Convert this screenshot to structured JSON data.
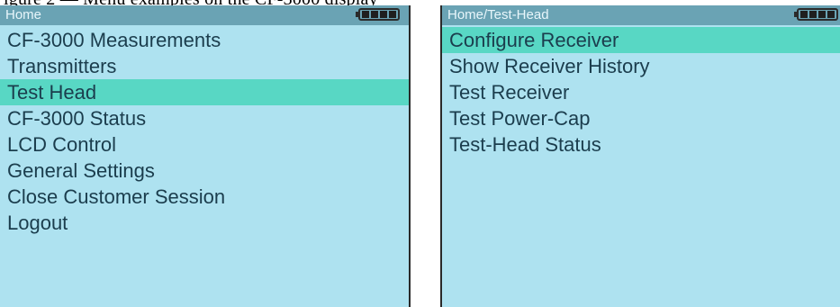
{
  "left_screen": {
    "breadcrumb": "Home",
    "battery_icon": "battery-full-icon",
    "menu_items": [
      {
        "label": "CF-3000 Measurements",
        "selected": false
      },
      {
        "label": "Transmitters",
        "selected": false
      },
      {
        "label": "Test Head",
        "selected": true
      },
      {
        "label": "CF-3000 Status",
        "selected": false
      },
      {
        "label": "LCD Control",
        "selected": false
      },
      {
        "label": "General Settings",
        "selected": false
      },
      {
        "label": "Close Customer Session",
        "selected": false
      },
      {
        "label": "Logout",
        "selected": false
      }
    ]
  },
  "right_screen": {
    "breadcrumb": "Home/Test-Head",
    "battery_icon": "battery-full-icon",
    "menu_items": [
      {
        "label": "Configure Receiver",
        "selected": true
      },
      {
        "label": "Show Receiver History",
        "selected": false
      },
      {
        "label": "Test Receiver",
        "selected": false
      },
      {
        "label": "Test Power-Cap",
        "selected": false
      },
      {
        "label": "Test-Head Status",
        "selected": false
      }
    ]
  },
  "colors": {
    "screen_background": "#aee2f0",
    "title_bar": "#6aa3b4",
    "selection_highlight": "#58d7c4",
    "menu_text": "#1b3d4d"
  }
}
